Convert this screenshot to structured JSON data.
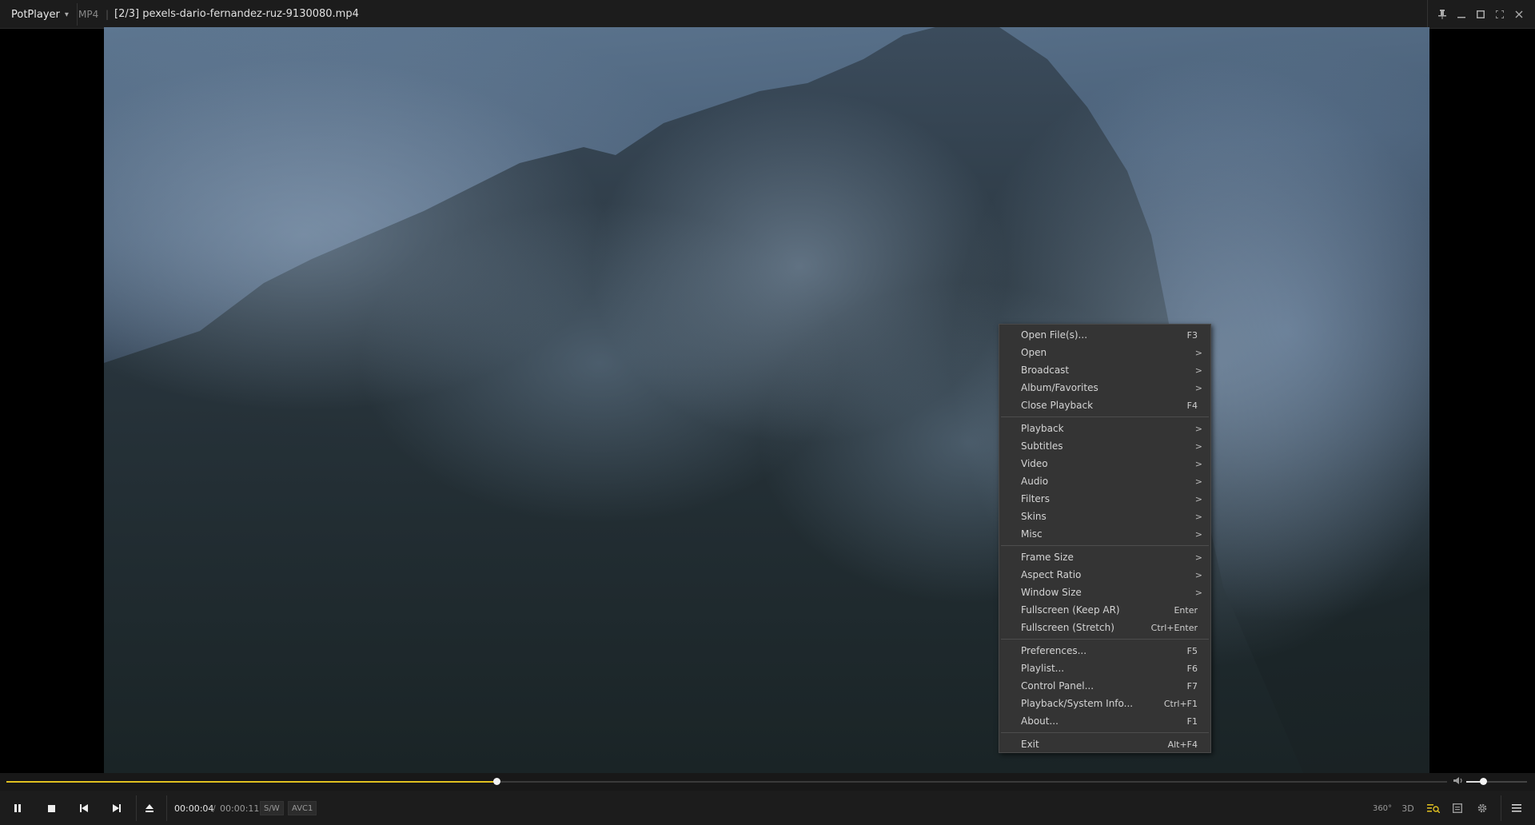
{
  "titlebar": {
    "app_name": "PotPlayer",
    "format": "MP4",
    "separator": "|",
    "file_title": "[2/3] pexels-dario-fernandez-ruz-9130080.mp4",
    "buttons": [
      "pin-icon",
      "minimize-icon",
      "maximize-icon",
      "fullscreen-icon",
      "close-icon"
    ]
  },
  "menu": {
    "groups": [
      [
        {
          "label": "Open File(s)...",
          "shortcut": "F3"
        },
        {
          "label": "Open",
          "shortcut": ">"
        },
        {
          "label": "Broadcast",
          "shortcut": ">"
        },
        {
          "label": "Album/Favorites",
          "shortcut": ">"
        },
        {
          "label": "Close Playback",
          "shortcut": "F4"
        }
      ],
      [
        {
          "label": "Playback",
          "shortcut": ">"
        },
        {
          "label": "Subtitles",
          "shortcut": ">"
        },
        {
          "label": "Video",
          "shortcut": ">"
        },
        {
          "label": "Audio",
          "shortcut": ">"
        },
        {
          "label": "Filters",
          "shortcut": ">"
        },
        {
          "label": "Skins",
          "shortcut": ">"
        },
        {
          "label": "Misc",
          "shortcut": ">"
        }
      ],
      [
        {
          "label": "Frame Size",
          "shortcut": ">"
        },
        {
          "label": "Aspect Ratio",
          "shortcut": ">"
        },
        {
          "label": "Window Size",
          "shortcut": ">"
        },
        {
          "label": "Fullscreen (Keep AR)",
          "shortcut": "Enter"
        },
        {
          "label": "Fullscreen (Stretch)",
          "shortcut": "Ctrl+Enter"
        }
      ],
      [
        {
          "label": "Preferences...",
          "shortcut": "F5"
        },
        {
          "label": "Playlist...",
          "shortcut": "F6"
        },
        {
          "label": "Control Panel...",
          "shortcut": "F7"
        },
        {
          "label": "Playback/System Info...",
          "shortcut": "Ctrl+F1"
        },
        {
          "label": "About...",
          "shortcut": "F1"
        }
      ],
      [
        {
          "label": "Exit",
          "shortcut": "Alt+F4"
        }
      ]
    ]
  },
  "seek": {
    "progress": 0.34,
    "volume": 0.28
  },
  "controls": {
    "current_time": "00:00:04",
    "time_separator": "/",
    "total_time": "00:00:11",
    "decoder_tag": "S/W",
    "codec_tag": "AVC1",
    "vr_label": "360°",
    "threed_label": "3D",
    "accent": "#e0c020"
  }
}
